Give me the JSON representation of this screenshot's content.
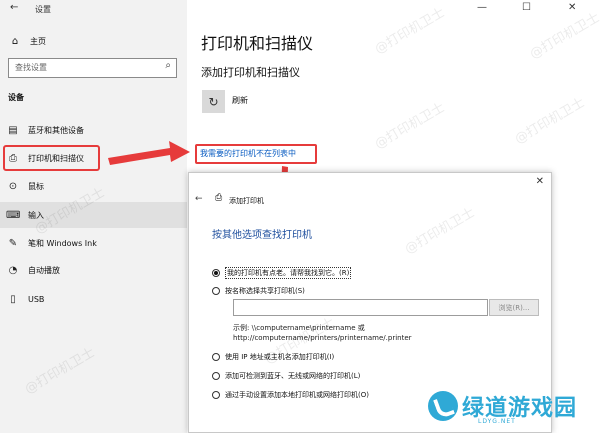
{
  "window": {
    "title": "设置",
    "controls": [
      "—",
      "☐",
      "✕"
    ]
  },
  "sidebar": {
    "home_label": "主页",
    "search_placeholder": "查找设置",
    "section_label": "设备",
    "items": [
      {
        "label": "蓝牙和其他设备",
        "icon": "bluetooth-devices-icon"
      },
      {
        "label": "打印机和扫描仪",
        "icon": "printer-icon"
      },
      {
        "label": "鼠标",
        "icon": "mouse-icon"
      },
      {
        "label": "输入",
        "icon": "keyboard-icon"
      },
      {
        "label": "笔和 Windows Ink",
        "icon": "pen-icon"
      },
      {
        "label": "自动播放",
        "icon": "autoplay-icon"
      },
      {
        "label": "USB",
        "icon": "usb-icon"
      }
    ],
    "selected_index": 1
  },
  "main": {
    "title": "打印机和扫描仪",
    "subtitle": "添加打印机和扫描仪",
    "refresh_label": "刷新",
    "missing_printer_link": "我需要的打印机不在列表中"
  },
  "dialog": {
    "title": "添加打印机",
    "heading": "按其他选项查找打印机",
    "options": [
      {
        "label": "我的打印机有点老。请帮我找到它。(R)",
        "selected": true
      },
      {
        "label": "按名称选择共享打印机(S)",
        "selected": false
      },
      {
        "label": "使用 IP 地址或主机名添加打印机(I)",
        "selected": false
      },
      {
        "label": "添加可检测到蓝牙、无线或网络的打印机(L)",
        "selected": false
      },
      {
        "label": "通过手动设置添加本地打印机或网络打印机(O)",
        "selected": false
      }
    ],
    "browse_label": "浏览(R)...",
    "example_text": "示例: \\\\computername\\printername 或 http://computername/printers/printername/.printer"
  },
  "watermark": "@打印机卫士",
  "logo": {
    "text": "绿道游戏园",
    "sub": "LDYG.NET"
  },
  "colors": {
    "accent_link": "#0a5cc2",
    "annotation_red": "#e63b3b",
    "logo_blue": "#2fa9d6"
  }
}
